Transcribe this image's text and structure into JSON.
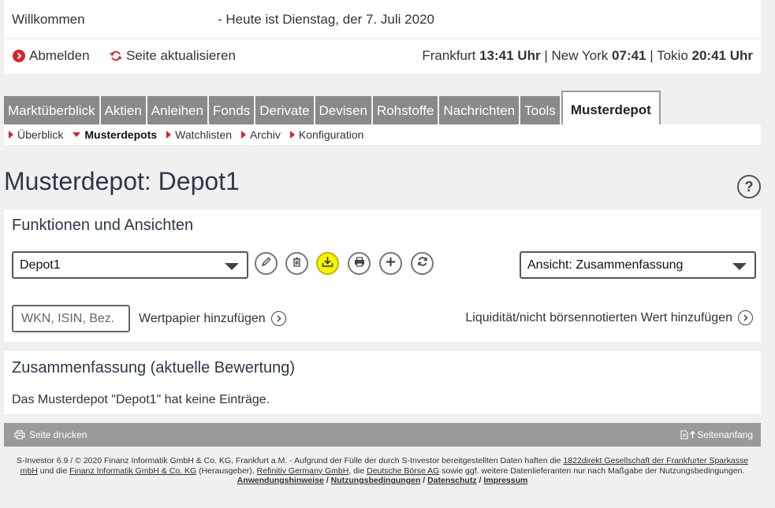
{
  "header": {
    "welcome": "Willkommen",
    "date_text": "- Heute ist Dienstag, der 7. Juli 2020",
    "logout_label": "Abmelden",
    "refresh_label": "Seite aktualisieren",
    "clock": {
      "frankfurt_label": "Frankfurt",
      "frankfurt_time": "13:41 Uhr",
      "newyork_label": "New York",
      "newyork_time": "07:41",
      "tokio_label": "Tokio",
      "tokio_time": "20:41 Uhr",
      "sep": "|"
    }
  },
  "tabs": [
    "Marktüberblick",
    "Aktien",
    "Anleihen",
    "Fonds",
    "Derivate",
    "Devisen",
    "Rohstoffe",
    "Nachrichten",
    "Tools",
    "Musterdepot"
  ],
  "active_tab": "Musterdepot",
  "subnav": [
    "Überblick",
    "Musterdepots",
    "Watchlisten",
    "Archiv",
    "Konfiguration"
  ],
  "active_subnav": "Musterdepots",
  "page_title": "Musterdepot: Depot1",
  "help_label": "?",
  "functions": {
    "heading": "Funktionen und Ansichten",
    "depot_select": "Depot1",
    "view_select": "Ansicht: Zusammenfassung",
    "search_placeholder": "WKN, ISIN, Bez.",
    "add_security_label": "Wertpapier hinzufügen",
    "add_liquidity_label": "Liquidität/nicht börsennotierten Wert hinzufügen"
  },
  "summary": {
    "heading": "Zusammenfassung (aktuelle Bewertung)",
    "empty_text": "Das Musterdepot \"Depot1\" hat keine Einträge."
  },
  "footer": {
    "print_label": "Seite drucken",
    "top_label": "Seitenanfang",
    "legal_prefix": "S-Investor 6.9 / © 2020 Finanz Informatik GmbH & Co. KG, Frankfurt a.M. - Aufgrund der Fülle der durch S-Investor bereitgestellten Daten haften die",
    "legal_link1": "1822direkt Gesellschaft der Frankfurter Sparkasse mbH",
    "legal_mid1": "und die",
    "legal_link2": "Finanz Informatik GmbH & Co. KG",
    "legal_mid2": "(Herausgeber),",
    "legal_link3": "Refinitiv Germany GmbH",
    "legal_mid3": ", die",
    "legal_link4": "Deutsche Börse AG",
    "legal_suffix": "sowie ggf. weitere Datenlieferanten nur nach Maßgabe der Nutzungsbedingungen.",
    "links": [
      "Anwendungshinweise",
      "Nutzungsbedingungen",
      "Datenschutz",
      "Impressum"
    ]
  },
  "colors": {
    "accent_red": "#d8222a",
    "tab_gray": "#8a8a8a",
    "highlight_yellow": "#f6f600",
    "title_navy": "#2a3a4a"
  }
}
